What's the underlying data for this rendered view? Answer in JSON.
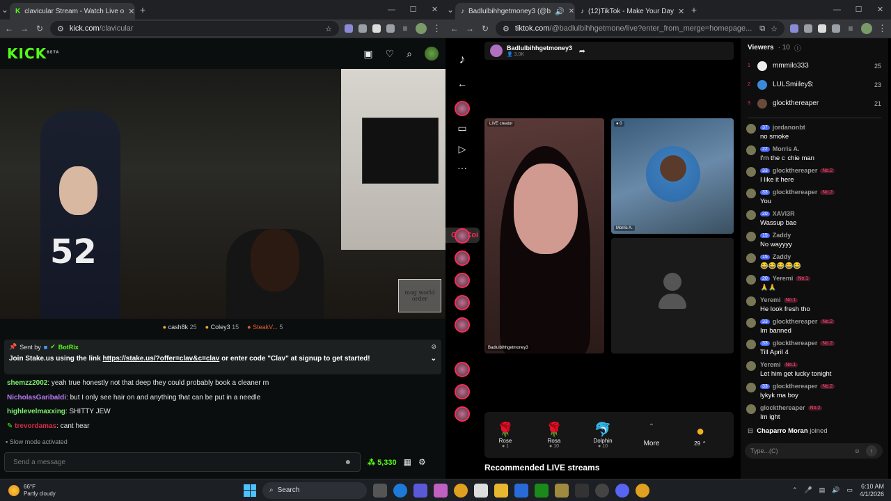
{
  "left": {
    "tab_title": "clavicular Stream - Watch Live o",
    "url_host": "kick.com",
    "url_path": "/clavicular",
    "kick": {
      "logo": "KICK",
      "logo_badge": "BETA",
      "gifters": [
        {
          "name": "cash8k",
          "count": "25"
        },
        {
          "name": "Coley3",
          "count": "15"
        },
        {
          "name": "SteakV...",
          "count": "5"
        }
      ],
      "watermark": "mog world order",
      "pinned": {
        "sent_by_label": "Sent by",
        "sender": "BotRix",
        "message_pre": "Join Stake.us using the link",
        "link": "https://stake.us/?offer=clav&c=clav",
        "message_post": "or enter code \"Clav\" at signup to get started!"
      },
      "messages": [
        {
          "user": "shemzz2002",
          "text": " yeah true honestly not that deep they could probably book a cleaner rn"
        },
        {
          "user": "NicholasGaribaldi",
          "text": " but I only see hair on and anything that can be put in a needle"
        },
        {
          "user": "highlevelmaxxing",
          "text": " SHITTY JEW"
        },
        {
          "user": "trevordamas",
          "text": " cant hear"
        }
      ],
      "slow_mode": "Slow mode activated",
      "send_placeholder": "Send a message",
      "points": "5,330"
    }
  },
  "right": {
    "tabs": [
      "Badlulbihhgetmoney3 (@b",
      "(12)TikTok - Make Your Day"
    ],
    "url_host": "tiktok.com",
    "url_path": "/@badlulbihhgetmone/live?enter_from_merge=homepage...",
    "tiktok": {
      "host_name": "Badlulbihhgetmoney3",
      "host_viewers": "3.0K",
      "get_coins": "Get Coi",
      "cell1_label": "LIVE creator",
      "cell1_name": "Badlulbihhgetmoney3",
      "cell2_count": "0",
      "cell2_name": "Morris A.",
      "gifts": [
        {
          "name": "Rose",
          "price": "1",
          "icon": "🌹"
        },
        {
          "name": "Rosa",
          "price": "10",
          "icon": "🌹"
        },
        {
          "name": "Dolphin",
          "price": "10",
          "icon": "🐬"
        }
      ],
      "more_label": "More",
      "coins_count": "29",
      "recommended": "Recommended LIVE streams",
      "viewers_label": "Viewers",
      "viewers_count": "· 10",
      "top_viewers": [
        {
          "rank": "1",
          "name": "mmmilo333",
          "score": "25"
        },
        {
          "rank": "2",
          "name": "LULSmiiley$:",
          "score": "23"
        },
        {
          "rank": "3",
          "name": "glockthereaper",
          "score": "21"
        }
      ],
      "chat": [
        {
          "lvl": "37",
          "name": "jordanonbt",
          "rank": "",
          "text": "no smoke"
        },
        {
          "lvl": "22",
          "name": "Morris A.",
          "rank": "",
          "text": "I'm the c  chie man"
        },
        {
          "lvl": "33",
          "name": "glockthereaper",
          "rank": "No.2",
          "text": "I like it here"
        },
        {
          "lvl": "33",
          "name": "glockthereaper",
          "rank": "No.2",
          "text": "You"
        },
        {
          "lvl": "20",
          "name": "XAVI3R",
          "rank": "",
          "text": "Wassup bae"
        },
        {
          "lvl": "15",
          "name": "Zaddy",
          "rank": "",
          "text": "No wayyyy"
        },
        {
          "lvl": "15",
          "name": "Zaddy",
          "rank": "",
          "text": "😂😂😂😂😂"
        },
        {
          "lvl": "20",
          "name": "Yeremi",
          "rank": "No.1",
          "text": "🙏🙏"
        },
        {
          "lvl": "",
          "name": "Yeremi",
          "rank": "No.1",
          "text": "He look fresh tho"
        },
        {
          "lvl": "33",
          "name": "glockthereaper",
          "rank": "No.2",
          "text": "Im banned"
        },
        {
          "lvl": "33",
          "name": "glockthereaper",
          "rank": "No.2",
          "text": "Till April 4"
        },
        {
          "lvl": "",
          "name": "Yeremi",
          "rank": "No.1",
          "text": "Let him get lucky tonight"
        },
        {
          "lvl": "33",
          "name": "glockthereaper",
          "rank": "No.2",
          "text": "lykyk ma boy"
        },
        {
          "lvl": "",
          "name": "glockthereaper",
          "rank": "No.2",
          "text": "Im ight"
        }
      ],
      "joined_name": "Chaparro Moran",
      "joined_text": "joined",
      "input_placeholder": "Type...(C)"
    }
  },
  "taskbar": {
    "temp": "66°F",
    "weather": "Partly cloudy",
    "search": "Search",
    "time": "6:10 AM",
    "date": "4/1/2026"
  },
  "colors": {
    "kick_green": "#53fc18",
    "tiktok_red": "#fe2c55"
  }
}
